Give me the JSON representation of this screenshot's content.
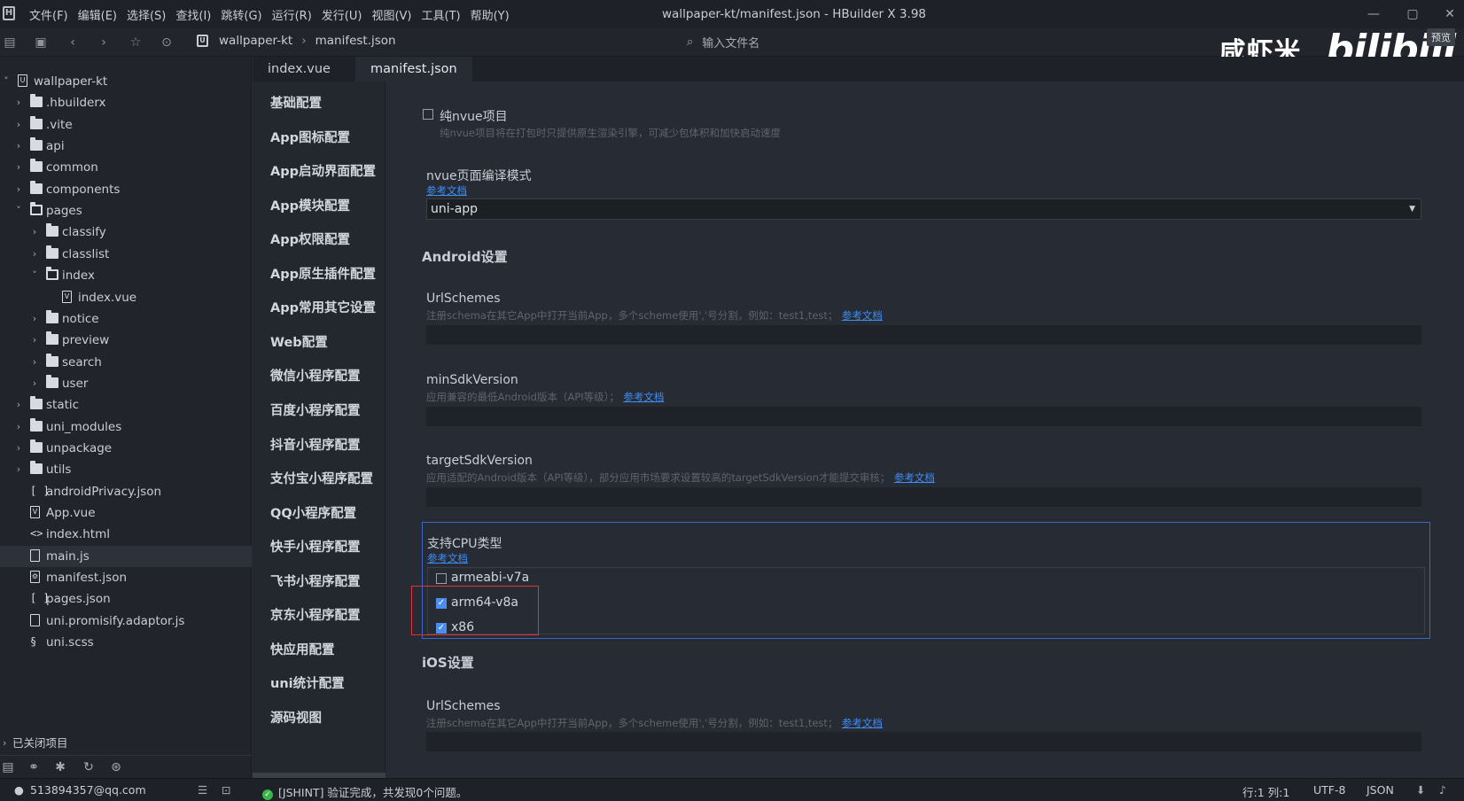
{
  "window": {
    "title": "wallpaper-kt/manifest.json - HBuilder X 3.98",
    "logo": "H",
    "controls": {
      "minimize": "—",
      "maximize": "▢",
      "close": "✕"
    }
  },
  "menu": [
    "文件(F)",
    "编辑(E)",
    "选择(S)",
    "查找(I)",
    "跳转(G)",
    "运行(R)",
    "发行(U)",
    "视图(V)",
    "工具(T)",
    "帮助(Y)"
  ],
  "toolbar": {
    "breadcrumb": {
      "project_icon": "U",
      "project": "wallpaper-kt",
      "separator": "›",
      "file": "manifest.json"
    },
    "file_search_placeholder": "输入文件名"
  },
  "watermark": {
    "text": "咸虾米_",
    "brand": "bilibili",
    "badge": "预览"
  },
  "explorer": {
    "rows": [
      {
        "label": "wallpaper-kt",
        "type": "project",
        "chevron": "˅"
      },
      {
        "label": ".hbuilderx",
        "type": "folder",
        "chevron": "›"
      },
      {
        "label": ".vite",
        "type": "folder",
        "chevron": "›"
      },
      {
        "label": "api",
        "type": "folder",
        "chevron": "›"
      },
      {
        "label": "common",
        "type": "folder",
        "chevron": "›"
      },
      {
        "label": "components",
        "type": "folder",
        "chevron": "›"
      },
      {
        "label": "pages",
        "type": "folder-open",
        "chevron": "˅"
      },
      {
        "label": "classify",
        "type": "folder",
        "chevron": "›"
      },
      {
        "label": "classlist",
        "type": "folder",
        "chevron": "›"
      },
      {
        "label": "index",
        "type": "folder-open",
        "chevron": "˅"
      },
      {
        "label": "index.vue",
        "type": "vue"
      },
      {
        "label": "notice",
        "type": "folder",
        "chevron": "›"
      },
      {
        "label": "preview",
        "type": "folder",
        "chevron": "›"
      },
      {
        "label": "search",
        "type": "folder",
        "chevron": "›"
      },
      {
        "label": "user",
        "type": "folder",
        "chevron": "›"
      },
      {
        "label": "static",
        "type": "folder",
        "chevron": "›"
      },
      {
        "label": "uni_modules",
        "type": "folder",
        "chevron": "›"
      },
      {
        "label": "unpackage",
        "type": "folder",
        "chevron": "›"
      },
      {
        "label": "utils",
        "type": "folder",
        "chevron": "›"
      },
      {
        "label": "androidPrivacy.json",
        "type": "json"
      },
      {
        "label": "App.vue",
        "type": "vue"
      },
      {
        "label": "index.html",
        "type": "html"
      },
      {
        "label": "main.js",
        "type": "js",
        "selected": true
      },
      {
        "label": "manifest.json",
        "type": "manifest"
      },
      {
        "label": "pages.json",
        "type": "json"
      },
      {
        "label": "uni.promisify.adaptor.js",
        "type": "js"
      },
      {
        "label": "uni.scss",
        "type": "scss"
      }
    ],
    "closed_projects": "已关闭项目",
    "tools": [
      "files-icon",
      "binoculars-icon",
      "bug-icon",
      "sync-icon",
      "plugin-icon"
    ]
  },
  "tabs": [
    {
      "label": "index.vue",
      "active": false
    },
    {
      "label": "manifest.json",
      "active": true
    }
  ],
  "config_nav": [
    "基础配置",
    "App图标配置",
    "App启动界面配置",
    "App模块配置",
    "App权限配置",
    "App原生插件配置",
    "App常用其它设置",
    "Web配置",
    "微信小程序配置",
    "百度小程序配置",
    "抖音小程序配置",
    "支付宝小程序配置",
    "QQ小程序配置",
    "快手小程序配置",
    "飞书小程序配置",
    "京东小程序配置",
    "快应用配置",
    "uni统计配置",
    "源码视图"
  ],
  "content": {
    "pure_nvue": {
      "label": "纯nvue项目",
      "desc": "纯nvue项目将在打包时只提供原生渲染引擎，可减少包体积和加快启动速度",
      "checked": false
    },
    "nvue_compile": {
      "label": "nvue页面编译模式",
      "link": "参考文档",
      "value": "uni-app",
      "arrow": "▼"
    },
    "android_title": "Android设置",
    "url_schemes": {
      "label": "UrlSchemes",
      "desc": "注册schema在其它App中打开当前App，多个scheme使用','号分割，例如：test1,test；",
      "link": "参考文档",
      "value": ""
    },
    "min_sdk": {
      "label": "minSdkVersion",
      "desc": "应用兼容的最低Android版本（API等级）；",
      "link": "参考文档",
      "value": ""
    },
    "target_sdk": {
      "label": "targetSdkVersion",
      "desc": "应用适配的Android版本（API等级），部分应用市场要求设置较高的targetSdkVersion才能提交审核；",
      "link": "参考文档",
      "value": ""
    },
    "cpu": {
      "label": "支持CPU类型",
      "link": "参考文档",
      "options": [
        {
          "label": "armeabi-v7a",
          "checked": false
        },
        {
          "label": "arm64-v8a",
          "checked": true
        },
        {
          "label": "x86",
          "checked": true
        }
      ],
      "check_mark": "✓"
    },
    "ios_title": "iOS设置",
    "ios_url_schemes": {
      "label": "UrlSchemes",
      "desc": "注册schema在其它App中打开当前App，多个scheme使用','号分割，例如：test1,test；",
      "link": "参考文档",
      "value": ""
    }
  },
  "statusbar": {
    "account": "513894357@qq.com",
    "lint_ok_icon": "✓",
    "lint": "[JSHINT] 验证完成，共发现0个问题。",
    "position": "行:1  列:1",
    "encoding": "UTF-8",
    "language": "JSON"
  },
  "colors": {
    "accent": "#3e8ef7",
    "checkbox": "#4c8ef0",
    "highlight_box": "#e0343c",
    "cpu_border": "#3f65c8",
    "ok": "#39b54a"
  }
}
